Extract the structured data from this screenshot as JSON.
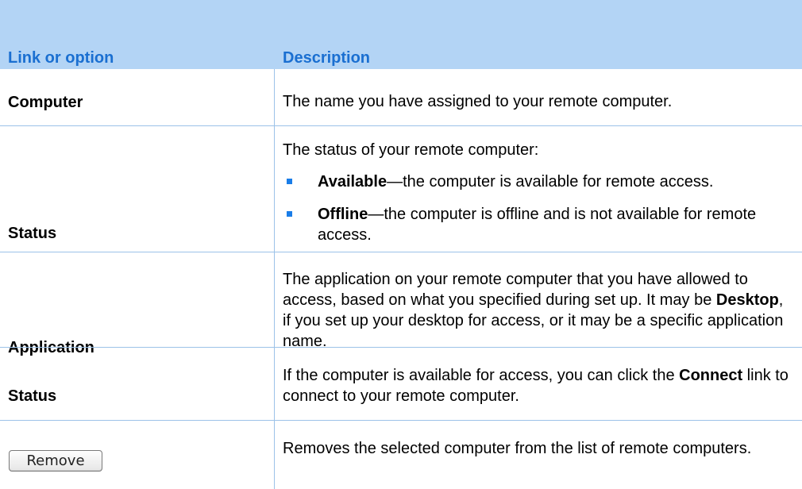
{
  "header": {
    "col1": "Link or option",
    "col2": "Description"
  },
  "rows": [
    {
      "label": "Computer",
      "desc": "The name you have assigned to your remote computer."
    },
    {
      "label": "Status",
      "desc_intro": "The status of your remote computer:",
      "bullets": [
        {
          "term": "Available",
          "text": "—the computer is available for remote access."
        },
        {
          "term": "Offline",
          "text": "—the computer is offline and is not available for remote access."
        }
      ]
    },
    {
      "label": "Application",
      "desc_before": "The application on your remote computer that you have allowed to access, based on what you specified during set up. It may be ",
      "desc_bold": "Desktop",
      "desc_after": ", if you set up your desktop for access, or it may be a specific application name."
    },
    {
      "label": "Status",
      "desc_before": "If the computer is available for access, you can click the ",
      "desc_bold": "Connect",
      "desc_after": " link to connect to your remote computer."
    },
    {
      "button_label": "Remove",
      "desc": "Removes the selected computer from the list of remote computers."
    }
  ],
  "colors": {
    "header_bg": "#b3d4f5",
    "header_text": "#1a6fd1",
    "border": "#9cc2e8",
    "bullet": "#1a7de8"
  }
}
